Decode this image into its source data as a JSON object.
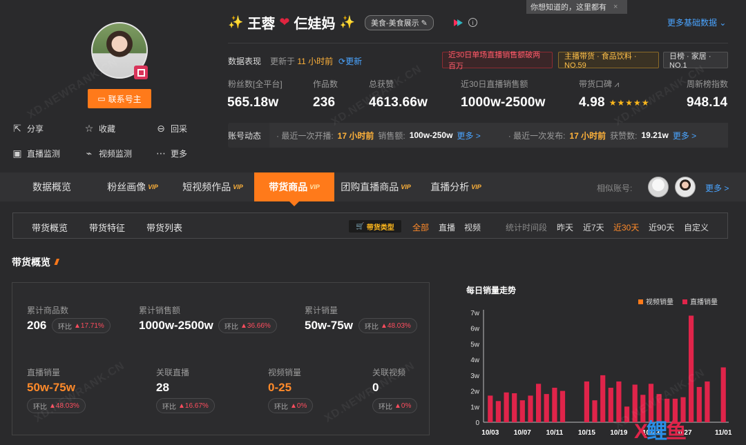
{
  "profile": {
    "name_left": "王蓉",
    "name_right": "仨娃妈",
    "category": "美食-美食展示",
    "contact_label": "联系号主",
    "actions": [
      {
        "label": "分享",
        "icon": "share-icon"
      },
      {
        "label": "收藏",
        "icon": "star-icon"
      },
      {
        "label": "回采",
        "icon": "refresh-collect-icon"
      },
      {
        "label": "直播监测",
        "icon": "live-monitor-icon"
      },
      {
        "label": "视频监测",
        "icon": "chart-monitor-icon"
      },
      {
        "label": "更多",
        "icon": "more-icon"
      }
    ]
  },
  "tooltip": "你想知道的，这里都有",
  "more_basic": "更多基础数据",
  "perf": {
    "label": "数据表现",
    "updated_prefix": "更新于",
    "updated_time": "11 小时前",
    "refresh": "更新",
    "badges": [
      "近30日单场直播销售额破两百万",
      "主播带货 · 食品饮料 · NO.59",
      "日榜 · 家居 · NO.1"
    ]
  },
  "stats": [
    {
      "label": "粉丝数[全平台]",
      "value": "565.18w"
    },
    {
      "label": "作品数",
      "value": "236"
    },
    {
      "label": "总获赞",
      "value": "4613.66w"
    },
    {
      "label": "近30日直播销售额",
      "value": "1000w-2500w"
    },
    {
      "label": "带货口碑",
      "value": "4.98"
    },
    {
      "label": "周新榜指数",
      "value": "948.14"
    }
  ],
  "feed": {
    "title": "账号动态",
    "live_prefix": "· 最近一次开播:",
    "live_time": "17 小时前",
    "sales_label": "销售额:",
    "sales_value": "100w-250w",
    "more1": "更多 >",
    "post_prefix": "· 最近一次发布:",
    "post_time": "17 小时前",
    "likes_label": "获赞数:",
    "likes_value": "19.21w",
    "more2": "更多 >"
  },
  "tabs": [
    {
      "label": "数据概览",
      "vip": ""
    },
    {
      "label": "粉丝画像",
      "vip": "VIP"
    },
    {
      "label": "短视频作品",
      "vip": "VIP"
    },
    {
      "label": "带货商品",
      "vip": "VIP"
    },
    {
      "label": "团购直播商品",
      "vip": "VIP"
    },
    {
      "label": "直播分析",
      "vip": "VIP"
    }
  ],
  "similar_label": "相似账号:",
  "similar_more": "更多 >",
  "subtabs": [
    "带货概览",
    "带货特征",
    "带货列表"
  ],
  "type_chip": "带货类型",
  "filters": [
    "全部",
    "直播",
    "视频"
  ],
  "period_label": "统计时间段",
  "periods": [
    "昨天",
    "近7天",
    "近30天",
    "近90天",
    "自定义"
  ],
  "overview": {
    "title": "带货概览",
    "metrics": [
      {
        "label": "累计商品数",
        "value": "206",
        "yoy_label": "环比",
        "yoy": "17.71%"
      },
      {
        "label": "累计销售额",
        "value": "1000w-2500w",
        "yoy_label": "环比",
        "yoy": "36.66%"
      },
      {
        "label": "累计销量",
        "value": "50w-75w",
        "yoy_label": "环比",
        "yoy": "48.03%"
      },
      {
        "label": "直播销量",
        "value": "50w-75w",
        "yoy_label": "环比",
        "yoy": "48.03%"
      },
      {
        "label": "关联直播",
        "value": "28",
        "yoy_label": "环比",
        "yoy": "16.67%"
      },
      {
        "label": "视频销量",
        "value": "0-25",
        "yoy_label": "环比",
        "yoy": "0%"
      },
      {
        "label": "关联视频",
        "value": "0",
        "yoy_label": "环比",
        "yoy": "0%"
      }
    ]
  },
  "colors": {
    "accent": "#ff7a1a",
    "live_bar": "#e0244a",
    "video_bar": "#ff7a1a",
    "link": "#4aa4ff"
  },
  "chart_data": {
    "type": "bar",
    "title": "每日销量走势",
    "legend": [
      "视频销量",
      "直播销量"
    ],
    "legend_position": "top-right",
    "y_ticks": [
      "0",
      "1w",
      "2w",
      "3w",
      "4w",
      "5w",
      "6w",
      "7w"
    ],
    "ylim": [
      0,
      70000
    ],
    "x_ticks": [
      "10/03",
      "10/07",
      "10/11",
      "10/15",
      "10/19",
      "10/23",
      "10/27",
      "11/01"
    ],
    "categories": [
      "10/03",
      "10/04",
      "10/05",
      "10/06",
      "10/07",
      "10/08",
      "10/09",
      "10/10",
      "10/11",
      "10/12",
      "10/13",
      "10/14",
      "10/15",
      "10/16",
      "10/17",
      "10/18",
      "10/19",
      "10/20",
      "10/21",
      "10/22",
      "10/23",
      "10/24",
      "10/25",
      "10/26",
      "10/27",
      "10/28",
      "10/29",
      "10/30",
      "10/31",
      "11/01"
    ],
    "series": [
      {
        "name": "视频销量",
        "values": [
          0,
          0,
          0,
          0,
          0,
          0,
          0,
          0,
          0,
          0,
          0,
          0,
          0,
          0,
          0,
          0,
          0,
          0,
          0,
          0,
          0,
          0,
          0,
          0,
          0,
          0,
          0,
          0,
          0,
          0
        ]
      },
      {
        "name": "直播销量",
        "values": [
          17000,
          13500,
          19000,
          18500,
          14000,
          17000,
          24500,
          18000,
          22000,
          20000,
          0,
          0,
          26000,
          14000,
          30000,
          22000,
          26000,
          10000,
          24000,
          17500,
          24500,
          18000,
          15000,
          15000,
          16000,
          68000,
          22500,
          26000,
          0,
          35000
        ]
      }
    ]
  }
}
